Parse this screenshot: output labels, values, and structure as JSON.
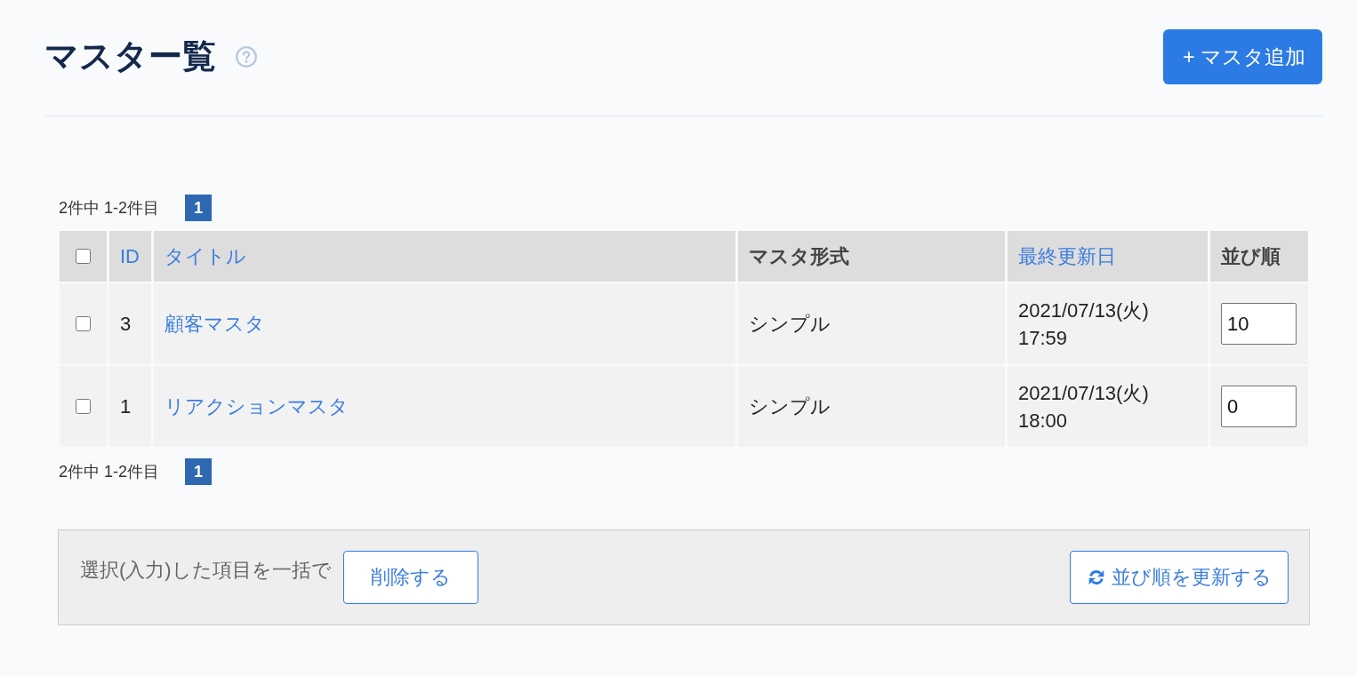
{
  "header": {
    "title": "マスター覧",
    "add_button": "+ マスタ追加"
  },
  "pager_top": {
    "summary": "2件中 1-2件目",
    "pages": [
      {
        "label": "1",
        "selected": true
      }
    ]
  },
  "table": {
    "select_all": {
      "checked": false
    },
    "columns": [
      {
        "label": "ID",
        "sortable": true
      },
      {
        "label": "タイトル",
        "sortable": true
      },
      {
        "label": "マスタ形式",
        "sortable": false
      },
      {
        "label": "最終更新日",
        "sortable": true
      },
      {
        "label": "並び順",
        "sortable": false
      }
    ],
    "rows": [
      {
        "checked": false,
        "id": "3",
        "title": "顧客マスタ",
        "format": "シンプル",
        "updated_date": "2021/07/13(火)",
        "updated_time": "17:59",
        "order": "10"
      },
      {
        "checked": false,
        "id": "1",
        "title": "リアクションマスタ",
        "format": "シンプル",
        "updated_date": "2021/07/13(火)",
        "updated_time": "18:00",
        "order": "0"
      }
    ]
  },
  "pager_bottom": {
    "summary": "2件中 1-2件目",
    "pages": [
      {
        "label": "1",
        "selected": true
      }
    ]
  },
  "bulk_actions": {
    "label": "選択(入力)した項目を一括で",
    "delete_button": "削除する",
    "update_order_button": "並び順を更新する"
  }
}
